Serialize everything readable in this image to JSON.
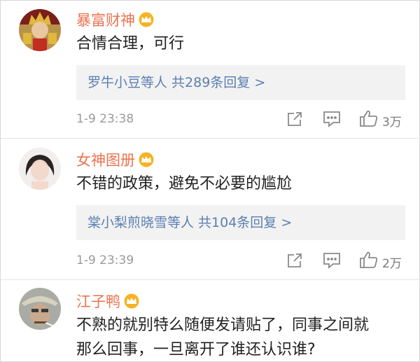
{
  "comments": [
    {
      "username": "暴富财神",
      "text": "合情合理，可行",
      "reply_summary": "罗牛小豆等人 共289条回复",
      "reply_arrow": ">",
      "time": "1-9 23:38",
      "likes": "3万",
      "avatar_icon": "god-of-wealth-avatar"
    },
    {
      "username": "女神图册",
      "text": "不错的政策，避免不必要的尴尬",
      "reply_summary": "棠小梨煎晓雪等人 共104条回复",
      "reply_arrow": ">",
      "time": "1-9 23:39",
      "likes": "2万",
      "avatar_icon": "girl-avatar"
    },
    {
      "username": "江子鸭",
      "text_line1": "不熟的就别特么随便发请贴了，同事之间就",
      "text_line2": "那么回事，一旦离开了谁还认识谁?",
      "avatar_icon": "man-in-hat-avatar"
    }
  ],
  "colors": {
    "username": "#eb7350",
    "link": "#5b7fb1",
    "meta": "#9a9a9a",
    "reply_bg": "#f2f2f2",
    "crown": "#f5b323"
  }
}
